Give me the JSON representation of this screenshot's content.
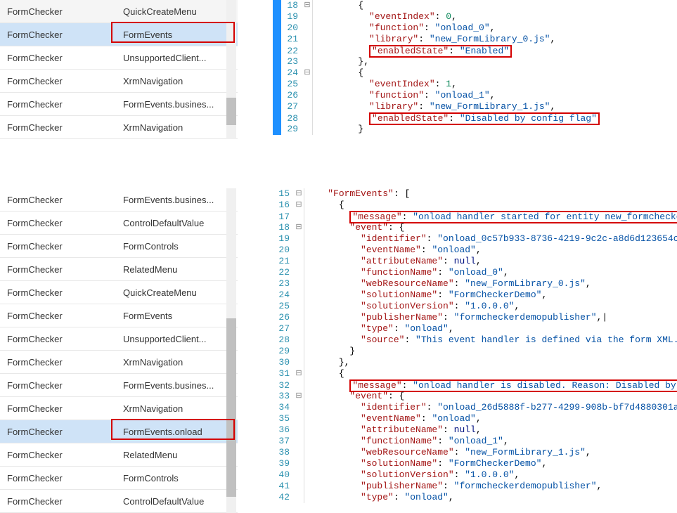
{
  "topPanel": {
    "listRows": [
      {
        "a": "FormChecker",
        "b": "QuickCreateMenu",
        "selected": false
      },
      {
        "a": "FormChecker",
        "b": "FormEvents",
        "selected": true
      },
      {
        "a": "FormChecker",
        "b": "UnsupportedClient...",
        "selected": false
      },
      {
        "a": "FormChecker",
        "b": "XrmNavigation",
        "selected": false
      },
      {
        "a": "FormChecker",
        "b": "FormEvents.busines...",
        "selected": false
      },
      {
        "a": "FormChecker",
        "b": "XrmNavigation",
        "selected": false
      }
    ],
    "redboxIndex": 1,
    "partialRowA": "",
    "partialRowB": "",
    "code": {
      "startLine": 18,
      "lines": [
        {
          "ln": 18,
          "indent": 6,
          "tokens": [
            {
              "t": "p",
              "v": "{"
            }
          ],
          "fold": "-",
          "blue": true
        },
        {
          "ln": 19,
          "indent": 8,
          "tokens": [
            {
              "t": "k",
              "v": "\"eventIndex\""
            },
            {
              "t": "p",
              "v": ": "
            },
            {
              "t": "n",
              "v": "0"
            },
            {
              "t": "p",
              "v": ","
            }
          ],
          "blue": true
        },
        {
          "ln": 20,
          "indent": 8,
          "tokens": [
            {
              "t": "k",
              "v": "\"function\""
            },
            {
              "t": "p",
              "v": ": "
            },
            {
              "t": "s",
              "v": "\"onload_0\""
            },
            {
              "t": "p",
              "v": ","
            }
          ],
          "blue": true
        },
        {
          "ln": 21,
          "indent": 8,
          "tokens": [
            {
              "t": "k",
              "v": "\"library\""
            },
            {
              "t": "p",
              "v": ": "
            },
            {
              "t": "s",
              "v": "\"new_FormLibrary_0.js\""
            },
            {
              "t": "p",
              "v": ","
            }
          ],
          "blue": true
        },
        {
          "ln": 22,
          "indent": 8,
          "tokens": [
            {
              "t": "k",
              "v": "\"enabledState\""
            },
            {
              "t": "p",
              "v": ": "
            },
            {
              "t": "s",
              "v": "\"Enabled\""
            }
          ],
          "hl": true,
          "blue": true
        },
        {
          "ln": 23,
          "indent": 6,
          "tokens": [
            {
              "t": "p",
              "v": "},"
            }
          ],
          "blue": true
        },
        {
          "ln": 24,
          "indent": 6,
          "tokens": [
            {
              "t": "p",
              "v": "{"
            }
          ],
          "fold": "-",
          "blue": true
        },
        {
          "ln": 25,
          "indent": 8,
          "tokens": [
            {
              "t": "k",
              "v": "\"eventIndex\""
            },
            {
              "t": "p",
              "v": ": "
            },
            {
              "t": "n",
              "v": "1"
            },
            {
              "t": "p",
              "v": ","
            }
          ],
          "blue": true
        },
        {
          "ln": 26,
          "indent": 8,
          "tokens": [
            {
              "t": "k",
              "v": "\"function\""
            },
            {
              "t": "p",
              "v": ": "
            },
            {
              "t": "s",
              "v": "\"onload_1\""
            },
            {
              "t": "p",
              "v": ","
            }
          ],
          "blue": true
        },
        {
          "ln": 27,
          "indent": 8,
          "tokens": [
            {
              "t": "k",
              "v": "\"library\""
            },
            {
              "t": "p",
              "v": ": "
            },
            {
              "t": "s",
              "v": "\"new_FormLibrary_1.js\""
            },
            {
              "t": "p",
              "v": ","
            }
          ],
          "blue": true
        },
        {
          "ln": 28,
          "indent": 8,
          "tokens": [
            {
              "t": "k",
              "v": "\"enabledState\""
            },
            {
              "t": "p",
              "v": ": "
            },
            {
              "t": "s",
              "v": "\"Disabled by config flag\""
            }
          ],
          "hl": true,
          "blue": true
        },
        {
          "ln": 29,
          "indent": 6,
          "tokens": [
            {
              "t": "p",
              "v": "}"
            }
          ],
          "blue": true
        }
      ]
    }
  },
  "bottomPanel": {
    "listRows": [
      {
        "a": "FormChecker",
        "b": "FormEvents.busines...",
        "selected": false
      },
      {
        "a": "FormChecker",
        "b": "ControlDefaultValue",
        "selected": false
      },
      {
        "a": "FormChecker",
        "b": "FormControls",
        "selected": false
      },
      {
        "a": "FormChecker",
        "b": "RelatedMenu",
        "selected": false
      },
      {
        "a": "FormChecker",
        "b": "QuickCreateMenu",
        "selected": false
      },
      {
        "a": "FormChecker",
        "b": "FormEvents",
        "selected": false
      },
      {
        "a": "FormChecker",
        "b": "UnsupportedClient...",
        "selected": false
      },
      {
        "a": "FormChecker",
        "b": "XrmNavigation",
        "selected": false
      },
      {
        "a": "FormChecker",
        "b": "FormEvents.busines...",
        "selected": false
      },
      {
        "a": "FormChecker",
        "b": "XrmNavigation",
        "selected": false
      },
      {
        "a": "FormChecker",
        "b": "FormEvents.onload",
        "selected": true
      },
      {
        "a": "FormChecker",
        "b": "RelatedMenu",
        "selected": false
      },
      {
        "a": "FormChecker",
        "b": "FormControls",
        "selected": false
      },
      {
        "a": "FormChecker",
        "b": "ControlDefaultValue",
        "selected": false
      }
    ],
    "redboxIndex": 10,
    "code": {
      "startLine": 15,
      "lines": [
        {
          "ln": 15,
          "indent": 2,
          "tokens": [
            {
              "t": "k",
              "v": "\"FormEvents\""
            },
            {
              "t": "p",
              "v": ": ["
            }
          ],
          "fold": "-"
        },
        {
          "ln": 16,
          "indent": 4,
          "tokens": [
            {
              "t": "p",
              "v": "{"
            }
          ],
          "fold": "-"
        },
        {
          "ln": 17,
          "indent": 6,
          "tokens": [
            {
              "t": "k",
              "v": "\"message\""
            },
            {
              "t": "p",
              "v": ": "
            },
            {
              "t": "s",
              "v": "\"onload handler started for entity new_formcheckerdemo.\""
            },
            {
              "t": "p",
              "v": ","
            }
          ],
          "hl": true
        },
        {
          "ln": 18,
          "indent": 6,
          "tokens": [
            {
              "t": "k",
              "v": "\"event\""
            },
            {
              "t": "p",
              "v": ": {"
            }
          ],
          "fold": "-"
        },
        {
          "ln": 19,
          "indent": 8,
          "tokens": [
            {
              "t": "k",
              "v": "\"identifier\""
            },
            {
              "t": "p",
              "v": ": "
            },
            {
              "t": "s",
              "v": "\"onload_0c57b933-8736-4219-9c2c-a8d6d123654c\""
            },
            {
              "t": "p",
              "v": ","
            }
          ]
        },
        {
          "ln": 20,
          "indent": 8,
          "tokens": [
            {
              "t": "k",
              "v": "\"eventName\""
            },
            {
              "t": "p",
              "v": ": "
            },
            {
              "t": "s",
              "v": "\"onload\""
            },
            {
              "t": "p",
              "v": ","
            }
          ]
        },
        {
          "ln": 21,
          "indent": 8,
          "tokens": [
            {
              "t": "k",
              "v": "\"attributeName\""
            },
            {
              "t": "p",
              "v": ": "
            },
            {
              "t": "nl",
              "v": "null"
            },
            {
              "t": "p",
              "v": ","
            }
          ]
        },
        {
          "ln": 22,
          "indent": 8,
          "tokens": [
            {
              "t": "k",
              "v": "\"functionName\""
            },
            {
              "t": "p",
              "v": ": "
            },
            {
              "t": "s",
              "v": "\"onload_0\""
            },
            {
              "t": "p",
              "v": ","
            }
          ]
        },
        {
          "ln": 23,
          "indent": 8,
          "tokens": [
            {
              "t": "k",
              "v": "\"webResourceName\""
            },
            {
              "t": "p",
              "v": ": "
            },
            {
              "t": "s",
              "v": "\"new_FormLibrary_0.js\""
            },
            {
              "t": "p",
              "v": ","
            }
          ]
        },
        {
          "ln": 24,
          "indent": 8,
          "tokens": [
            {
              "t": "k",
              "v": "\"solutionName\""
            },
            {
              "t": "p",
              "v": ": "
            },
            {
              "t": "s",
              "v": "\"FormCheckerDemo\""
            },
            {
              "t": "p",
              "v": ","
            }
          ]
        },
        {
          "ln": 25,
          "indent": 8,
          "tokens": [
            {
              "t": "k",
              "v": "\"solutionVersion\""
            },
            {
              "t": "p",
              "v": ": "
            },
            {
              "t": "s",
              "v": "\"1.0.0.0\""
            },
            {
              "t": "p",
              "v": ","
            }
          ]
        },
        {
          "ln": 26,
          "indent": 8,
          "tokens": [
            {
              "t": "k",
              "v": "\"publisherName\""
            },
            {
              "t": "p",
              "v": ": "
            },
            {
              "t": "s",
              "v": "\"formcheckerdemopublisher\""
            },
            {
              "t": "p",
              "v": ","
            }
          ],
          "caret": true
        },
        {
          "ln": 27,
          "indent": 8,
          "tokens": [
            {
              "t": "k",
              "v": "\"type\""
            },
            {
              "t": "p",
              "v": ": "
            },
            {
              "t": "s",
              "v": "\"onload\""
            },
            {
              "t": "p",
              "v": ","
            }
          ]
        },
        {
          "ln": 28,
          "indent": 8,
          "tokens": [
            {
              "t": "k",
              "v": "\"source\""
            },
            {
              "t": "p",
              "v": ": "
            },
            {
              "t": "s",
              "v": "\"This event handler is defined via the form XML.\""
            }
          ]
        },
        {
          "ln": 29,
          "indent": 6,
          "tokens": [
            {
              "t": "p",
              "v": "}"
            }
          ]
        },
        {
          "ln": 30,
          "indent": 4,
          "tokens": [
            {
              "t": "p",
              "v": "},"
            }
          ]
        },
        {
          "ln": 31,
          "indent": 4,
          "tokens": [
            {
              "t": "p",
              "v": "{"
            }
          ],
          "fold": "-"
        },
        {
          "ln": 32,
          "indent": 6,
          "tokens": [
            {
              "t": "k",
              "v": "\"message\""
            },
            {
              "t": "p",
              "v": ": "
            },
            {
              "t": "s",
              "v": "\"onload handler is disabled. Reason: Disabled by config flag\""
            },
            {
              "t": "p",
              "v": ","
            }
          ],
          "hl": true
        },
        {
          "ln": 33,
          "indent": 6,
          "tokens": [
            {
              "t": "k",
              "v": "\"event\""
            },
            {
              "t": "p",
              "v": ": {"
            }
          ],
          "fold": "-"
        },
        {
          "ln": 34,
          "indent": 8,
          "tokens": [
            {
              "t": "k",
              "v": "\"identifier\""
            },
            {
              "t": "p",
              "v": ": "
            },
            {
              "t": "s",
              "v": "\"onload_26d5888f-b277-4299-908b-bf7d4880301a\""
            },
            {
              "t": "p",
              "v": ","
            }
          ]
        },
        {
          "ln": 35,
          "indent": 8,
          "tokens": [
            {
              "t": "k",
              "v": "\"eventName\""
            },
            {
              "t": "p",
              "v": ": "
            },
            {
              "t": "s",
              "v": "\"onload\""
            },
            {
              "t": "p",
              "v": ","
            }
          ]
        },
        {
          "ln": 36,
          "indent": 8,
          "tokens": [
            {
              "t": "k",
              "v": "\"attributeName\""
            },
            {
              "t": "p",
              "v": ": "
            },
            {
              "t": "nl",
              "v": "null"
            },
            {
              "t": "p",
              "v": ","
            }
          ]
        },
        {
          "ln": 37,
          "indent": 8,
          "tokens": [
            {
              "t": "k",
              "v": "\"functionName\""
            },
            {
              "t": "p",
              "v": ": "
            },
            {
              "t": "s",
              "v": "\"onload_1\""
            },
            {
              "t": "p",
              "v": ","
            }
          ]
        },
        {
          "ln": 38,
          "indent": 8,
          "tokens": [
            {
              "t": "k",
              "v": "\"webResourceName\""
            },
            {
              "t": "p",
              "v": ": "
            },
            {
              "t": "s",
              "v": "\"new_FormLibrary_1.js\""
            },
            {
              "t": "p",
              "v": ","
            }
          ]
        },
        {
          "ln": 39,
          "indent": 8,
          "tokens": [
            {
              "t": "k",
              "v": "\"solutionName\""
            },
            {
              "t": "p",
              "v": ": "
            },
            {
              "t": "s",
              "v": "\"FormCheckerDemo\""
            },
            {
              "t": "p",
              "v": ","
            }
          ]
        },
        {
          "ln": 40,
          "indent": 8,
          "tokens": [
            {
              "t": "k",
              "v": "\"solutionVersion\""
            },
            {
              "t": "p",
              "v": ": "
            },
            {
              "t": "s",
              "v": "\"1.0.0.0\""
            },
            {
              "t": "p",
              "v": ","
            }
          ]
        },
        {
          "ln": 41,
          "indent": 8,
          "tokens": [
            {
              "t": "k",
              "v": "\"publisherName\""
            },
            {
              "t": "p",
              "v": ": "
            },
            {
              "t": "s",
              "v": "\"formcheckerdemopublisher\""
            },
            {
              "t": "p",
              "v": ","
            }
          ]
        },
        {
          "ln": 42,
          "indent": 8,
          "tokens": [
            {
              "t": "k",
              "v": "\"type\""
            },
            {
              "t": "p",
              "v": ": "
            },
            {
              "t": "s",
              "v": "\"onload\""
            },
            {
              "t": "p",
              "v": ","
            }
          ]
        }
      ]
    }
  }
}
